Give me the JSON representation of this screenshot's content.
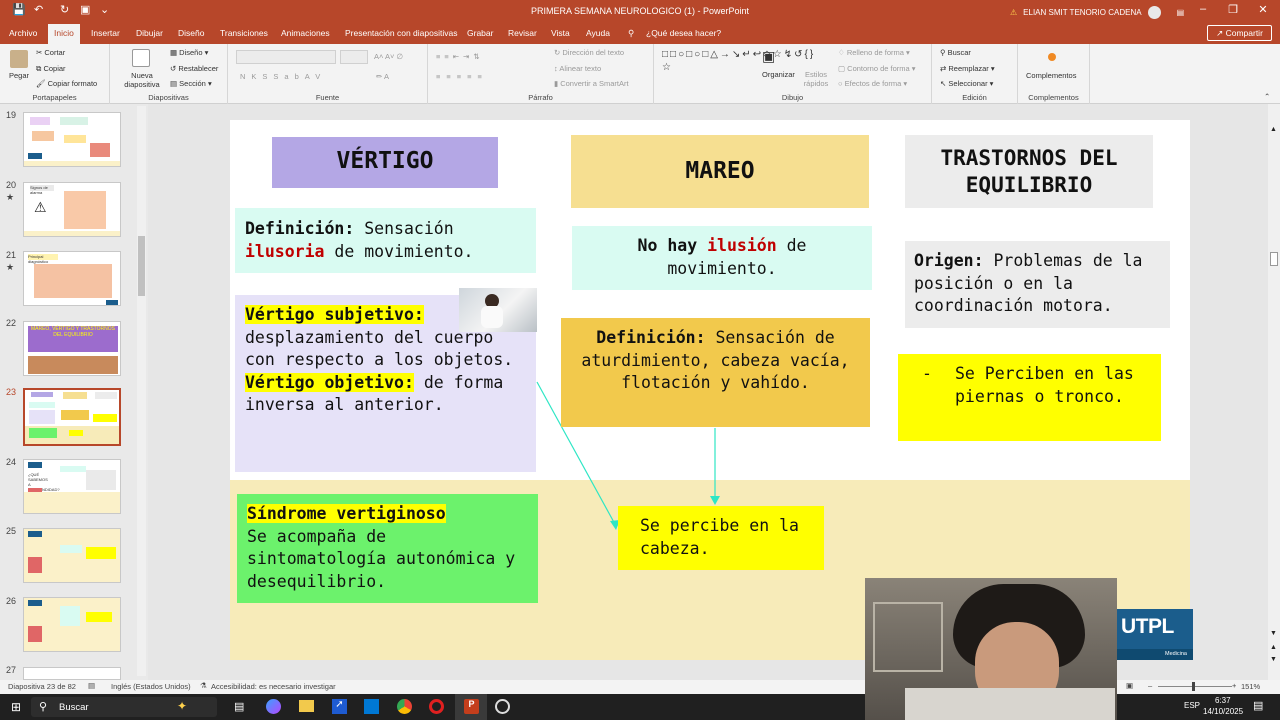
{
  "titlebar": {
    "title": "PRIMERA SEMANA NEUROLOGICO (1)  -  PowerPoint",
    "warning_icon": "warning-icon",
    "user": "ELIAN SMIT TENORIO CADENA"
  },
  "menu": {
    "tabs": [
      "Archivo",
      "Inicio",
      "Insertar",
      "Dibujar",
      "Diseño",
      "Transiciones",
      "Animaciones",
      "Presentación con diapositivas",
      "Grabar",
      "Revisar",
      "Vista",
      "Ayuda"
    ],
    "tell_me": "¿Qué desea hacer?",
    "share": "Compartir"
  },
  "ribbon": {
    "clipboard": {
      "paste": "Pegar",
      "cut": "Cortar",
      "copy": "Copiar",
      "format_painter": "Copiar formato",
      "label": "Portapapeles"
    },
    "slides": {
      "new_slide": "Nueva diapositiva",
      "layout": "Diseño",
      "reset": "Restablecer",
      "section": "Sección",
      "label": "Diapositivas"
    },
    "font": {
      "label": "Fuente"
    },
    "paragraph": {
      "text_direction": "Dirección del texto",
      "align_text": "Alinear texto",
      "smartart": "Convertir a SmartArt",
      "label": "Párrafo"
    },
    "drawing": {
      "arrange": "Organizar",
      "quick_styles": "Estilos rápidos",
      "fill": "Relleno de forma",
      "outline": "Contorno de forma",
      "effects": "Efectos de forma",
      "label": "Dibujo"
    },
    "editing": {
      "find": "Buscar",
      "replace": "Reemplazar",
      "select": "Seleccionar",
      "label": "Edición"
    },
    "addins": {
      "addins": "Complementos",
      "label": "Complementos"
    }
  },
  "thumbnails": [
    {
      "num": "19",
      "star": ""
    },
    {
      "num": "20",
      "star": "★"
    },
    {
      "num": "21",
      "star": "★"
    },
    {
      "num": "22",
      "star": ""
    },
    {
      "num": "23",
      "star": ""
    },
    {
      "num": "24",
      "star": ""
    },
    {
      "num": "25",
      "star": ""
    },
    {
      "num": "26",
      "star": ""
    },
    {
      "num": "27",
      "star": ""
    }
  ],
  "thumb_texts": {
    "t20": "Signos de alarma",
    "t21": "Principal diagnóstico",
    "t22": "MAREO, VÉRTIGO Y TRASTORNOS DEL EQUILIBRIO",
    "t24": "¿QUÉ SABEMOS A PROFUNDIDAD?"
  },
  "slide": {
    "vertigo": {
      "title": "VÉRTIGO",
      "def_label": "Definición:",
      "def_1": "Sensación",
      "def_2": "ilusoria",
      "def_3": "de movimiento.",
      "subj_label": "Vértigo subjetivo:",
      "subj_text": "desplazamiento del cuerpo con respecto a los objetos.",
      "obj_label": "Vértigo objetivo:",
      "obj_text": "de forma inversa al anterior.",
      "sind_label": "Síndrome vertiginoso",
      "sind_text": "Se acompaña de sintomatología autonómica y desequilibrio."
    },
    "mareo": {
      "title": "MAREO",
      "no_1": "No hay",
      "no_2": "ilusión",
      "no_3": "de movimiento.",
      "def_label": "Definición:",
      "def_text": "Sensación de aturdimiento, cabeza vacía, flotación y vahído.",
      "percibe": "Se percibe en la cabeza."
    },
    "trastornos": {
      "title": "TRASTORNOS DEL EQUILIBRIO",
      "origen_label": "Origen:",
      "origen_text": "Problemas de la posición o en la coordinación motora.",
      "dash": "-",
      "perciben": "Se Perciben en las piernas o tronco."
    },
    "logo": {
      "name": "UTPL",
      "sub": "Medicina"
    }
  },
  "status": {
    "slide_of": "Diapositiva 23 de 82",
    "language": "Inglés (Estados Unidos)",
    "accessibility": "Accesibilidad: es necesario investigar",
    "zoom": "151%"
  },
  "taskbar": {
    "search": "Buscar",
    "lang": "ESP",
    "time": "6:37",
    "date": "14/10/2025"
  },
  "colors": {
    "accent": "#b7472a",
    "vertigo_title": "#b4a7e5",
    "lavender": "#e6e2f8",
    "mint": "#d9fbf2",
    "mareo_title": "#f6df91",
    "mareo_def": "#f2c94c",
    "grey": "#ececec",
    "yellow": "#ffff00",
    "green": "#6cf26c",
    "band": "#f7ebb9"
  }
}
